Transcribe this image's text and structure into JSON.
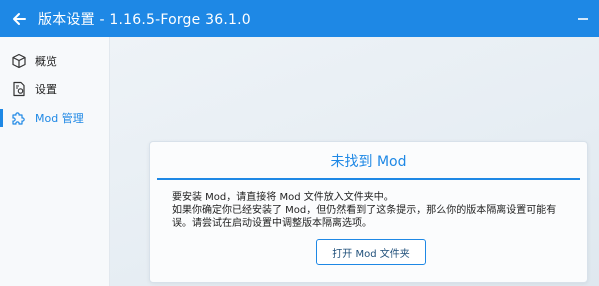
{
  "titlebar": {
    "title": "版本设置 - 1.16.5-Forge 36.1.0",
    "back_icon": "arrow-left-icon",
    "window_icon": "minimize-icon",
    "color": "#1e88e5"
  },
  "sidebar": {
    "items": [
      {
        "label": "概览",
        "icon": "cube-icon",
        "active": false
      },
      {
        "label": "设置",
        "icon": "settings-file-icon",
        "active": false
      },
      {
        "label": "Mod 管理",
        "icon": "puzzle-icon",
        "active": true
      }
    ]
  },
  "notice": {
    "title": "未找到 Mod",
    "line1": "要安装 Mod，请直接将 Mod 文件放入文件夹中。",
    "line2": "如果你确定你已经安装了 Mod，但仍然看到了这条提示，那么你的版本隔离设置可能有误。请尝试在启动设置中调整版本隔离选项。",
    "button_label": "打开 Mod 文件夹"
  }
}
